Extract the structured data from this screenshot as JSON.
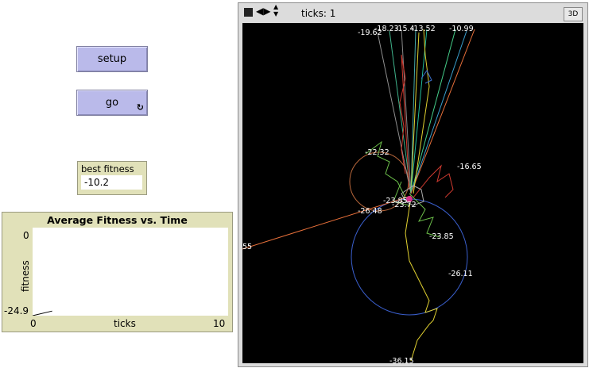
{
  "buttons": {
    "setup_label": "setup",
    "go_label": "go"
  },
  "monitor": {
    "label": "best fitness",
    "value": "-10.2"
  },
  "plot": {
    "title": "Average Fitness vs. Time",
    "ylabel": "fitness",
    "xlabel": "ticks",
    "y_max_label": "0",
    "y_min_label": "-24.9",
    "x_min_label": "0",
    "x_max_label": "10"
  },
  "chart_data": {
    "type": "line",
    "title": "Average Fitness vs. Time",
    "xlabel": "ticks",
    "ylabel": "fitness",
    "xlim": [
      0,
      10
    ],
    "ylim": [
      -24.9,
      0
    ],
    "series": [
      {
        "x": [
          0,
          1
        ],
        "values": [
          -24.9,
          -23.6
        ]
      }
    ]
  },
  "view": {
    "ticks_label": "ticks: 1",
    "btn_3d": "3D",
    "turtle_labels": [
      "-19.62",
      "-18.23",
      "-15.4",
      "-13.52",
      "-10.99",
      "-22.32",
      "-16.65",
      "-23.85",
      "-23.72",
      "-26.48",
      "55",
      "-23.85",
      "-26.11",
      "-36.15"
    ]
  },
  "colors": {
    "button_bg": "#babaea",
    "monitor_bg": "#e1e1b9",
    "view_bg": "#000000"
  }
}
